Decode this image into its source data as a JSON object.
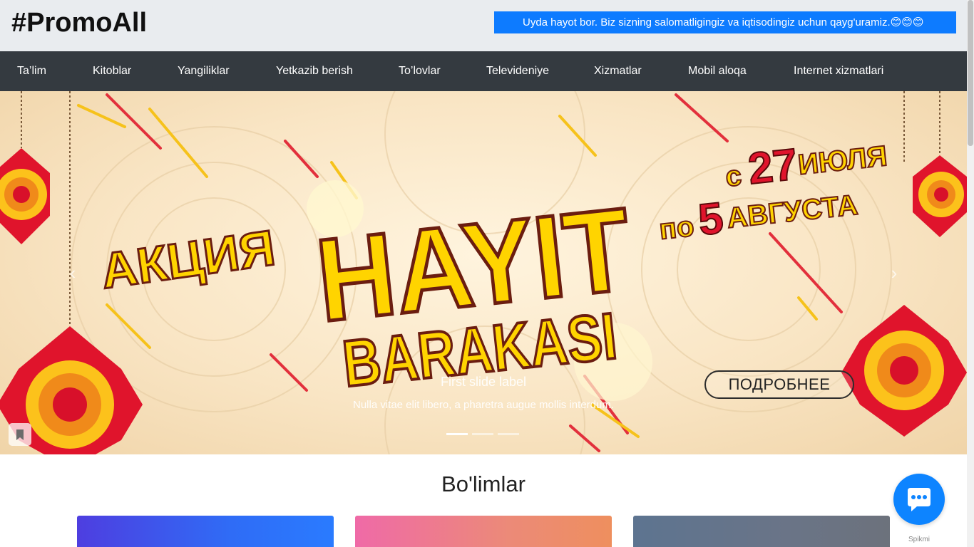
{
  "header": {
    "brand": "#PromoAll",
    "ticker": "Uyda hayot bor. Biz sizning salomatligingiz va iqtisodingiz uchun qayg'uramiz.😊😊😊"
  },
  "nav": {
    "items": [
      {
        "label": "Ta’lim"
      },
      {
        "label": "Kitoblar"
      },
      {
        "label": "Yangiliklar"
      },
      {
        "label": "Yetkazib berish"
      },
      {
        "label": "To’lovlar"
      },
      {
        "label": "Televideniye"
      },
      {
        "label": "Xizmatlar"
      },
      {
        "label": "Mobil aloqa"
      },
      {
        "label": "Internet xizmatlari"
      }
    ]
  },
  "carousel": {
    "banner": {
      "akcia": "АКЦИЯ",
      "hayit": "HAYIT",
      "barakasi": "BARAKASI",
      "date_s": "с",
      "date_27": "27",
      "date_iyulya": "ИЮЛЯ",
      "date_po": "по",
      "date_5": "5",
      "date_avgusta": "АВГУСТА",
      "button": "ПОДРОБНЕЕ"
    },
    "caption_title": "First slide label",
    "caption_text": "Nulla vitae elit libero, a pharetra augue mollis interdum.",
    "indicators": 3,
    "active_indicator": 1,
    "prev_icon": "chevron-left-icon",
    "next_icon": "chevron-right-icon"
  },
  "sections": {
    "title": "Bo'limlar"
  },
  "chat": {
    "label": "Spikmi",
    "icon": "chat-bubble-icon"
  },
  "colors": {
    "header_bg": "#e9ecef",
    "ticker_bg": "#0d7bff",
    "navbar_bg": "#343a40",
    "chat_bg": "#0d84ff",
    "banner_yellow": "#ffd400",
    "banner_red": "#d8102a"
  }
}
